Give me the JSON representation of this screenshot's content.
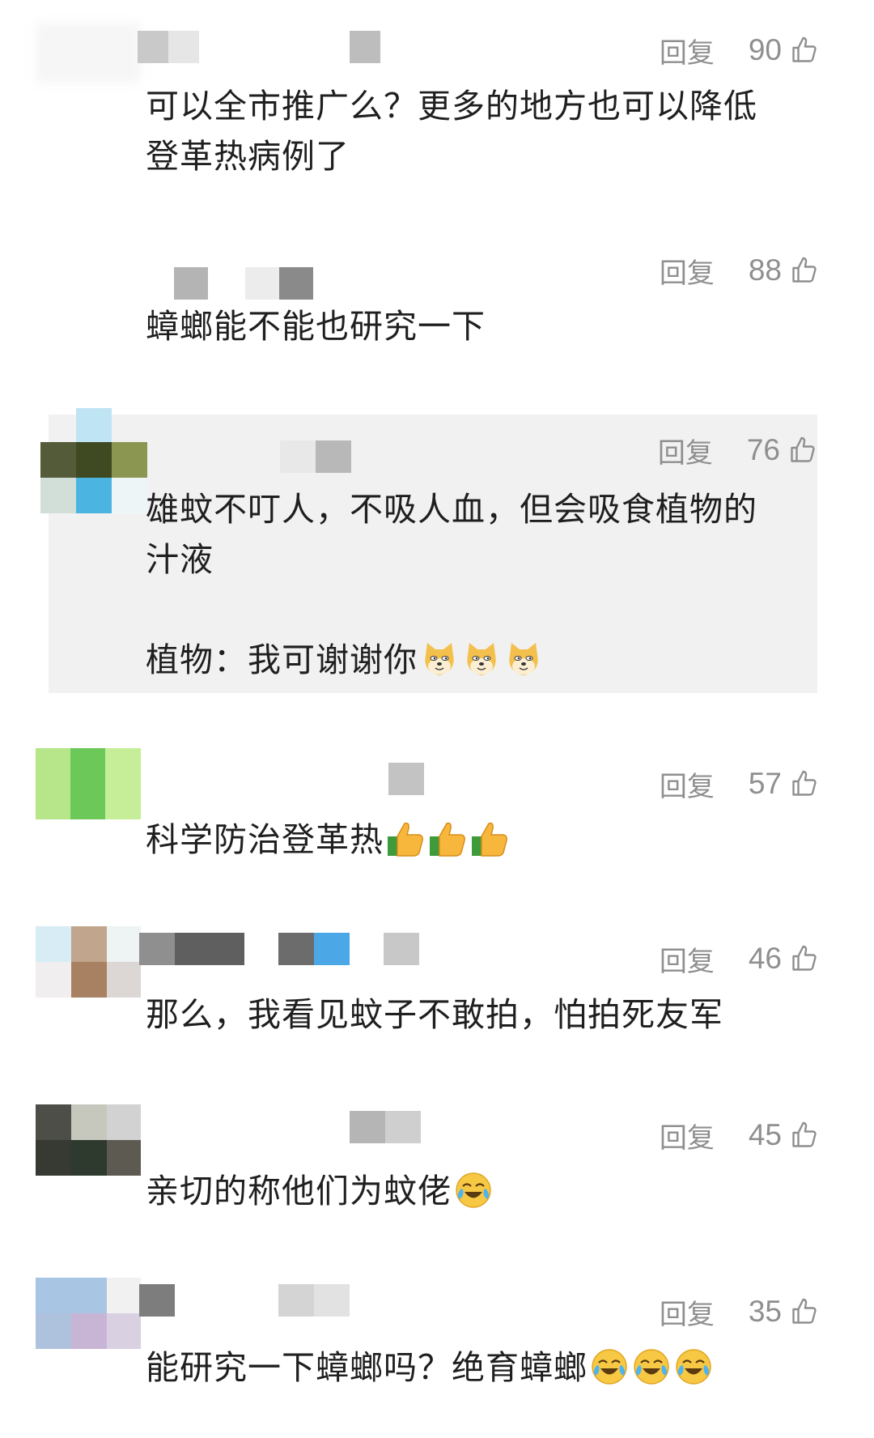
{
  "comments": [
    {
      "reply": "回复",
      "likes": "90",
      "text": "可以全市推广么？更多的地方也可以降低\n登革热病例了"
    },
    {
      "reply": "回复",
      "likes": "88",
      "text": "蟑螂能不能也研究一下"
    },
    {
      "reply": "回复",
      "likes": "76",
      "text": "雄蚊不叮人，不吸人血，但会吸食植物的\n汁液\n\n植物：我可谢谢你",
      "emojis": [
        "doge-emoji",
        "doge-emoji",
        "doge-emoji"
      ]
    },
    {
      "reply": "回复",
      "likes": "57",
      "text": "科学防治登革热",
      "emojis": [
        "thumbs-up-emoji",
        "thumbs-up-emoji",
        "thumbs-up-emoji"
      ]
    },
    {
      "reply": "回复",
      "likes": "46",
      "text": "那么，我看见蚊子不敢拍，怕拍死友军"
    },
    {
      "reply": "回复",
      "likes": "45",
      "text": "亲切的称他们为蚊佬",
      "emojis": [
        "laugh-cry-emoji"
      ]
    },
    {
      "reply": "回复",
      "likes": "35",
      "text": "能研究一下蟑螂吗？绝育蟑螂",
      "emojis": [
        "laugh-cry-emoji",
        "laugh-cry-emoji",
        "laugh-cry-emoji"
      ]
    }
  ],
  "colors": {
    "text": "#1f1f1f",
    "meta": "#8f8f8f",
    "highlight_bg": "#f1f1f1"
  }
}
